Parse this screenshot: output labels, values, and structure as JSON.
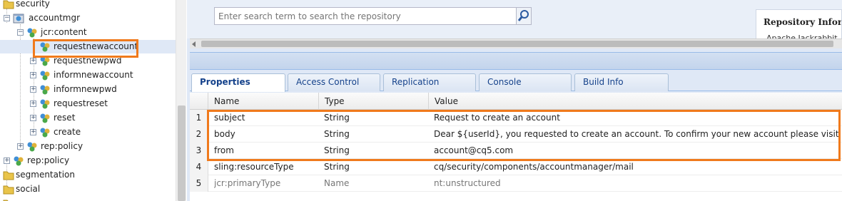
{
  "tree": {
    "items": [
      {
        "label": "security",
        "indent": 0
      },
      {
        "label": "accountmgr",
        "indent": 1
      },
      {
        "label": "jcr:content",
        "indent": 2
      },
      {
        "label": "requestnewaccount",
        "indent": 3
      },
      {
        "label": "requestnewpwd",
        "indent": 3
      },
      {
        "label": "informnewaccount",
        "indent": 3
      },
      {
        "label": "informnewpwd",
        "indent": 3
      },
      {
        "label": "requestreset",
        "indent": 3
      },
      {
        "label": "reset",
        "indent": 3
      },
      {
        "label": "create",
        "indent": 3
      },
      {
        "label": "rep:policy",
        "indent": 2
      },
      {
        "label": "rep:policy",
        "indent": 1
      },
      {
        "label": "segmentation",
        "indent": 0
      },
      {
        "label": "social",
        "indent": 0
      }
    ]
  },
  "search": {
    "placeholder": "Enter search term to search the repository"
  },
  "repo_panel": {
    "title": "Repository Infor",
    "subtitle": "Apache Jackrabbit"
  },
  "tabs": [
    {
      "label": "Properties",
      "active": true
    },
    {
      "label": "Access Control",
      "active": false
    },
    {
      "label": "Replication",
      "active": false
    },
    {
      "label": "Console",
      "active": false
    },
    {
      "label": "Build Info",
      "active": false
    }
  ],
  "grid": {
    "columns": [
      "Name",
      "Type",
      "Value"
    ],
    "rows": [
      {
        "num": "1",
        "name": "subject",
        "type": "String",
        "value": "Request to create an account"
      },
      {
        "num": "2",
        "name": "body",
        "type": "String",
        "value": "Dear ${userId}, you requested to create an account. To confirm your new account please visit ${actionurl}"
      },
      {
        "num": "3",
        "name": "from",
        "type": "String",
        "value": "account@cq5.com"
      },
      {
        "num": "4",
        "name": "sling:resourceType",
        "type": "String",
        "value": "cq/security/components/accountmanager/mail"
      },
      {
        "num": "5",
        "name": "jcr:primaryType",
        "type": "Name",
        "value": "nt:unstructured"
      }
    ]
  },
  "colors": {
    "highlight": "#f07a1c",
    "tab_text": "#15428b",
    "panel_bg": "#dfe8f6"
  }
}
